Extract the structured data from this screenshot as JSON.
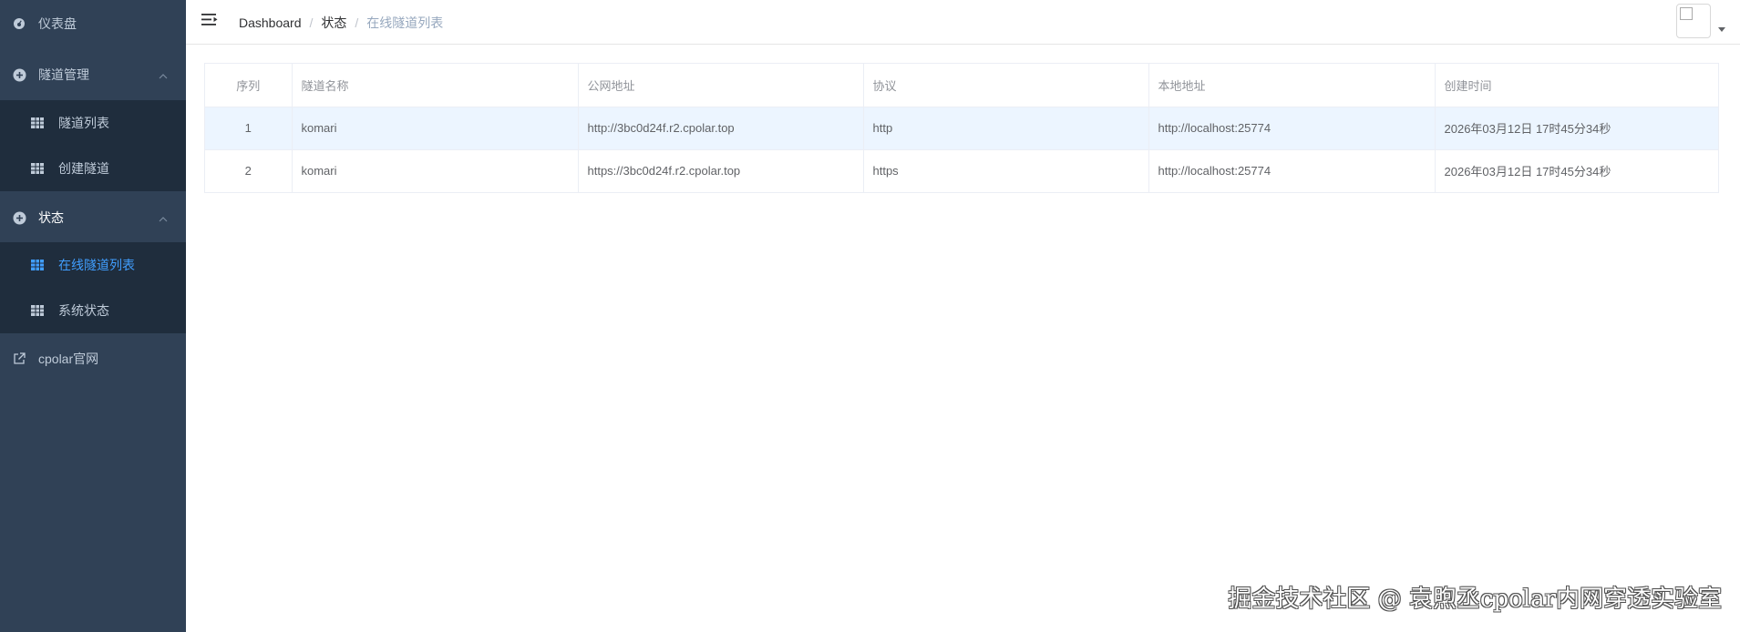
{
  "sidebar": {
    "dashboard": "仪表盘",
    "tunnel_mgmt": "隧道管理",
    "tunnel_list": "隧道列表",
    "create_tunnel": "创建隧道",
    "status": "状态",
    "online_tunnels": "在线隧道列表",
    "system_status": "系统状态",
    "cpolar_site": "cpolar官网"
  },
  "breadcrumb": {
    "home": "Dashboard",
    "parent": "状态",
    "current": "在线隧道列表",
    "separator": "/"
  },
  "table": {
    "headers": [
      "序列",
      "隧道名称",
      "公网地址",
      "协议",
      "本地地址",
      "创建时间"
    ],
    "rows": [
      [
        "1",
        "komari",
        "http://3bc0d24f.r2.cpolar.top",
        "http",
        "http://localhost:25774",
        "2026年03月12日 17时45分34秒"
      ],
      [
        "2",
        "komari",
        "https://3bc0d24f.r2.cpolar.top",
        "https",
        "http://localhost:25774",
        "2026年03月12日 17时45分34秒"
      ]
    ]
  },
  "watermark": "掘金技术社区 @ 袁煦丞cpolar内网穿透实验室",
  "colors": {
    "sidebar_bg": "#304156",
    "submenu_bg": "#1f2d3d",
    "accent": "#409eff",
    "row_highlight": "#ecf5ff"
  }
}
